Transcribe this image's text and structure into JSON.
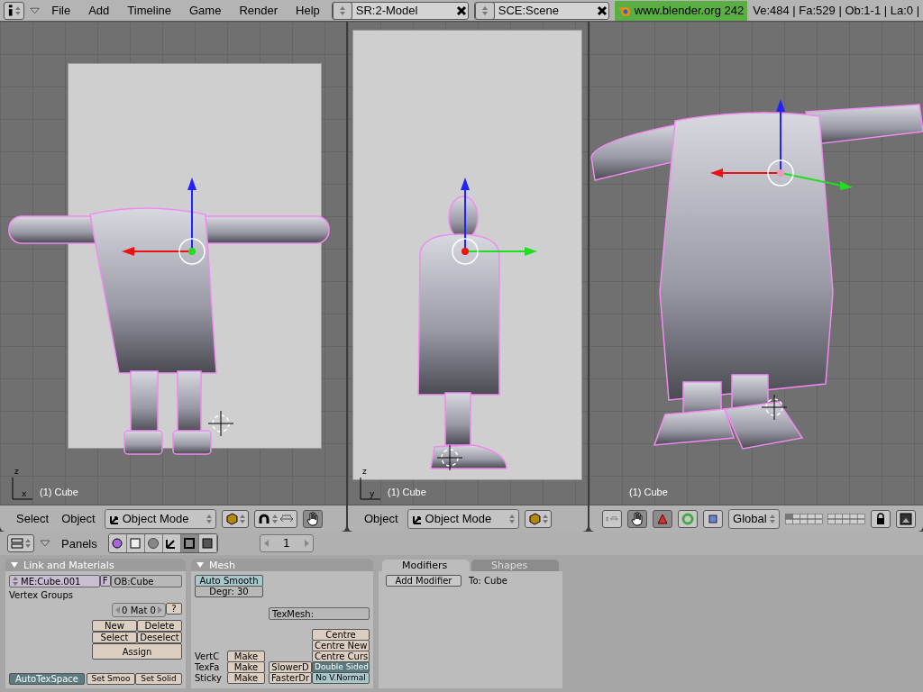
{
  "top_bar": {
    "menus": [
      "File",
      "Add",
      "Timeline",
      "Game",
      "Render",
      "Help"
    ],
    "screen": "SR:2-Model",
    "scene": "SCE:Scene",
    "version": "www.blender.org 242",
    "stats": "Ve:484 | Fa:529 | Ob:1-1 | La:0 |"
  },
  "viewports": [
    {
      "kind": "front",
      "reference_image": true,
      "label": "(1) Cube",
      "axis": [
        "z",
        "x"
      ],
      "header": [
        {
          "kind": "menu",
          "label": "Select"
        },
        {
          "kind": "menu",
          "label": "Object"
        },
        {
          "kind": "mode",
          "label": "Object Mode"
        },
        {
          "kind": "shading"
        },
        {
          "kind": "pivot"
        },
        {
          "kind": "hand",
          "on": true
        }
      ]
    },
    {
      "kind": "side",
      "reference_image": true,
      "label": "(1) Cube",
      "axis": [
        "z",
        "y"
      ],
      "header": [
        {
          "kind": "menu",
          "label": "Object"
        },
        {
          "kind": "mode",
          "label": "Object Mode"
        },
        {
          "kind": "shading"
        }
      ]
    },
    {
      "kind": "perspective",
      "label": "(1) Cube",
      "header": [
        {
          "kind": "snap"
        },
        {
          "kind": "hand",
          "on": true
        },
        {
          "kind": "translate",
          "on": true
        },
        {
          "kind": "rotate",
          "on": false
        },
        {
          "kind": "scale",
          "on": false
        },
        {
          "kind": "orientation",
          "label": "Global"
        },
        {
          "kind": "layers"
        },
        {
          "kind": "lock"
        },
        {
          "kind": "render"
        }
      ]
    }
  ],
  "buttons_window": {
    "header": {
      "label": "Panels",
      "context_tabs": [
        {
          "selected": false
        },
        {
          "selected": false
        },
        {
          "selected": false
        },
        {
          "selected": false
        },
        {
          "selected": true
        },
        {
          "selected": false
        }
      ],
      "page": "1"
    },
    "link_materials": {
      "title": "Link and Materials",
      "mesh_name": "ME:Cube.001",
      "fake_user": "F",
      "object_name": "OB:Cube",
      "vertex_groups": "Vertex Groups",
      "material_index": "0 Mat 0",
      "help": "?",
      "buttons": [
        "New",
        "Delete",
        "Select",
        "Deselect"
      ],
      "assign": "Assign",
      "auto_tex_space": {
        "label": "AutoTexSpace",
        "on": true
      },
      "set_smooth": "Set Smoo",
      "set_solid": "Set Solid"
    },
    "mesh": {
      "title": "Mesh",
      "auto_smooth": {
        "label": "Auto Smooth",
        "on": false
      },
      "degree": "Degr: 30",
      "tex_mesh": "TexMesh:",
      "centre_buttons": [
        "Centre",
        "Centre New",
        "Centre Curs"
      ],
      "make_rows": [
        {
          "label": "VertC",
          "button": "Make"
        },
        {
          "label": "TexFa",
          "button": "Make"
        },
        {
          "label": "Sticky",
          "button": "Make"
        }
      ],
      "draw_speed": [
        "SlowerD",
        "FasterDr"
      ],
      "toggles": [
        {
          "label": "Double Sided",
          "on": true
        },
        {
          "label": "No V.Normal",
          "on": false
        }
      ]
    },
    "modifiers": {
      "tabs": [
        {
          "label": "Modifiers",
          "selected": true
        },
        {
          "label": "Shapes",
          "selected": false
        }
      ],
      "add": "Add Modifier",
      "target": "To: Cube"
    }
  }
}
